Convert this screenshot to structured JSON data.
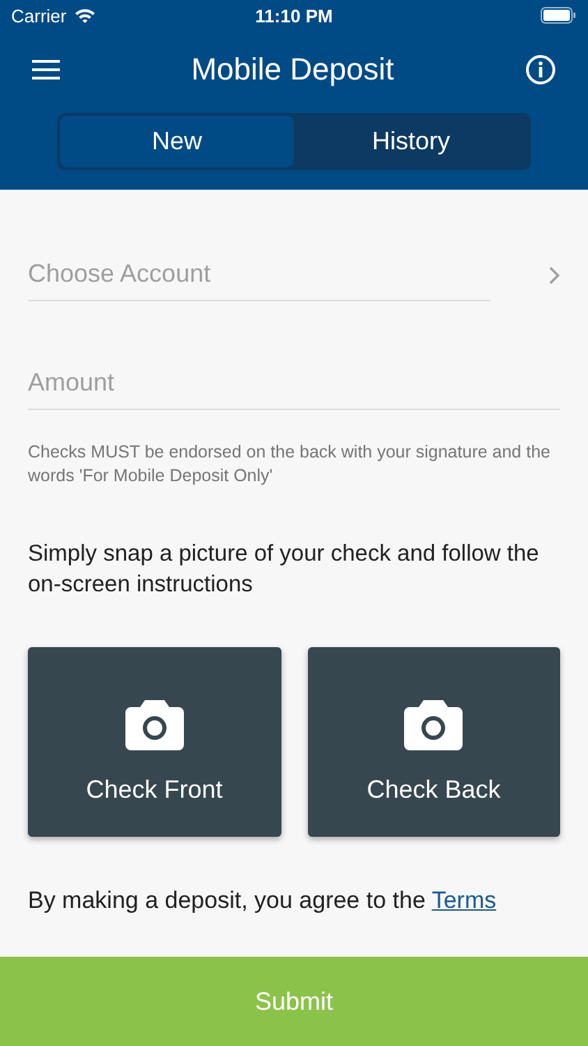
{
  "status_bar": {
    "carrier": "Carrier",
    "time": "11:10 PM"
  },
  "header": {
    "title": "Mobile Deposit"
  },
  "tabs": [
    {
      "label": "New",
      "selected": true
    },
    {
      "label": "History",
      "selected": false
    }
  ],
  "fields": [
    {
      "placeholder": "Choose Account",
      "kind": "picker"
    },
    {
      "placeholder": "Amount",
      "kind": "text"
    }
  ],
  "note": "Checks MUST be endorsed on the back with your signature and the words 'For Mobile Deposit Only'",
  "instruction": "Simply snap a picture of your check and follow the on-screen instructions",
  "capture_buttons": [
    {
      "label": "Check Front"
    },
    {
      "label": "Check Back"
    }
  ],
  "agreement": {
    "text": "By making a deposit, you agree to the",
    "link": "Terms"
  },
  "submit": "Submit"
}
